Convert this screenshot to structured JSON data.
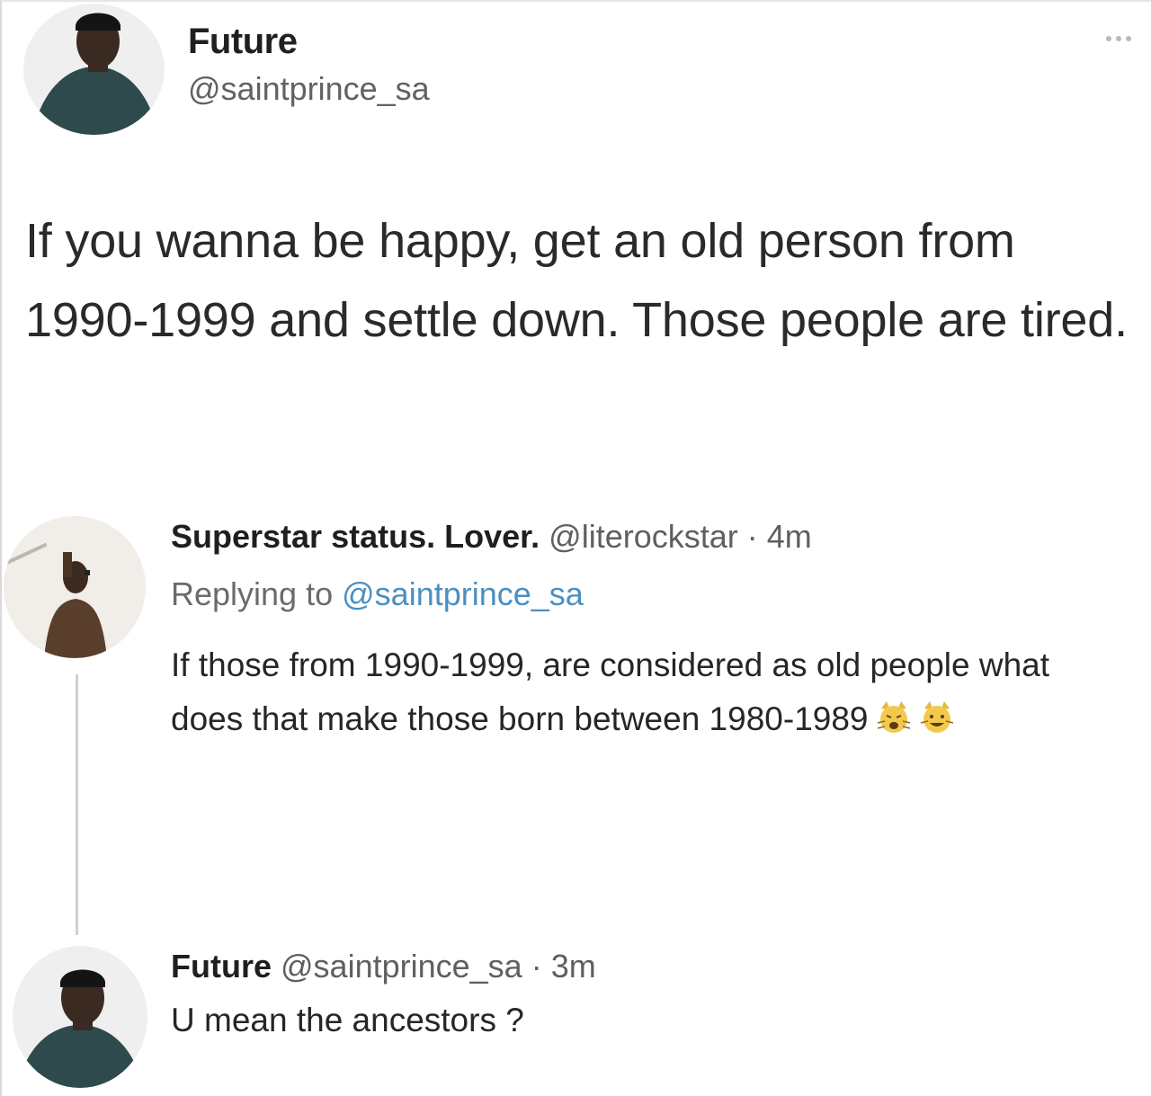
{
  "main_tweet": {
    "display_name": "Future",
    "handle": "@saintprince_sa",
    "text": "If you wanna be happy, get an old person from 1990-1999 and settle down. Those people are tired.",
    "avatar_icon": "person-avatar-icon",
    "more_icon": "more-options-icon"
  },
  "reply_1": {
    "display_name": "Superstar status. Lover.",
    "handle_and_time": "@literockstar · 4m",
    "replying_prefix": "Replying to",
    "replying_mention": "@saintprince_sa",
    "text": "If those from 1990-1999, are considered as old people what does that make those born between 1980-1989",
    "emojis": [
      "weary-cat-face-icon",
      "grinning-cat-face-icon"
    ],
    "avatar_icon": "person-avatar-icon"
  },
  "reply_2": {
    "display_name": "Future",
    "handle_and_time": "@saintprince_sa · 3m",
    "text": "U mean the ancestors ?",
    "avatar_icon": "person-avatar-icon"
  }
}
